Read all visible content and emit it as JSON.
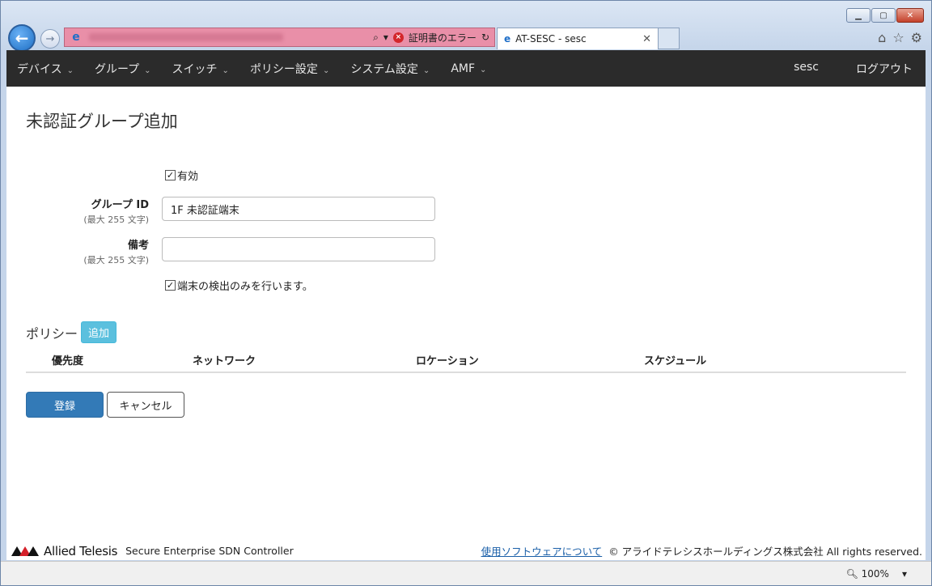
{
  "browser": {
    "cert_error": "証明書のエラー",
    "tab_title": "AT-SESC - sesc",
    "search_glyph": "⌕",
    "refresh_glyph": "↻",
    "close_glyph": "✕",
    "ie_glyph": "e"
  },
  "navbar": {
    "items": [
      {
        "label": "デバイス"
      },
      {
        "label": "グループ"
      },
      {
        "label": "スイッチ"
      },
      {
        "label": "ポリシー設定"
      },
      {
        "label": "システム設定"
      },
      {
        "label": "AMF"
      }
    ],
    "user": "sesc",
    "logout": "ログアウト"
  },
  "page": {
    "title": "未認証グループ追加"
  },
  "form": {
    "enabled_label": "有効",
    "enabled_checked": true,
    "group_id_label": "グループ ID",
    "group_id_hint": "(最大 255 文字)",
    "group_id_value": "1F 未認証端末",
    "remarks_label": "備考",
    "remarks_hint": "(最大 255 文字)",
    "remarks_value": "",
    "detect_only_label": "端末の検出のみを行います。",
    "detect_only_checked": true
  },
  "policy": {
    "title": "ポリシー",
    "add_label": "追加",
    "columns": [
      "優先度",
      "ネットワーク",
      "ロケーション",
      "スケジュール"
    ]
  },
  "actions": {
    "submit": "登録",
    "cancel": "キャンセル"
  },
  "footer": {
    "brand": "Allied Telesis",
    "product": "Secure Enterprise SDN Controller",
    "software_link": "使用ソフトウェアについて",
    "copyright": "© アライドテレシスホールディングス株式会社 All rights reserved."
  },
  "status": {
    "zoom": "100%"
  },
  "colors": {
    "navbar": "#2b2b2b",
    "primary": "#337ab7",
    "info": "#5bc0de",
    "address_error": "#e98fa8"
  }
}
